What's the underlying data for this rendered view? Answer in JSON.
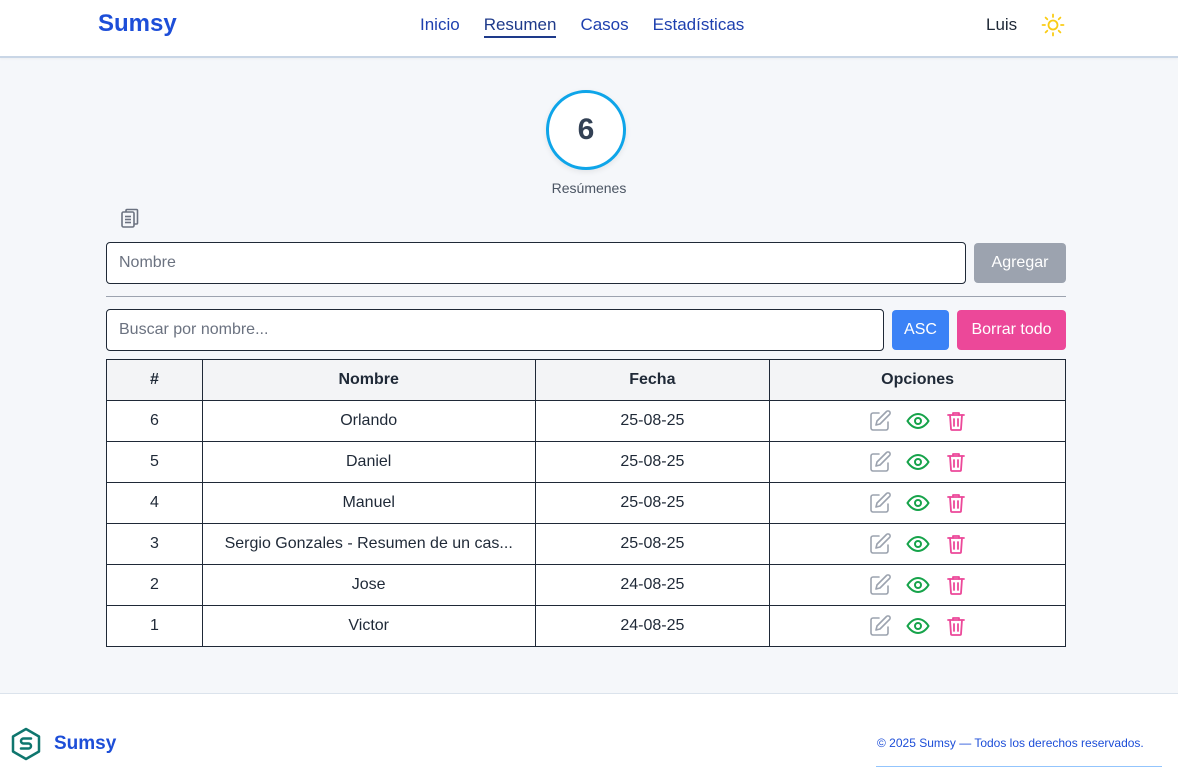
{
  "header": {
    "brand": "Sumsy",
    "nav": [
      {
        "label": "Inicio",
        "active": false
      },
      {
        "label": "Resumen",
        "active": true
      },
      {
        "label": "Casos",
        "active": false
      },
      {
        "label": "Estadísticas",
        "active": false
      }
    ],
    "user": "Luis",
    "theme_icon": "sun-icon"
  },
  "summary": {
    "count": "6",
    "label": "Resúmenes",
    "copy_icon": "clipboard-icon"
  },
  "add_form": {
    "name_placeholder": "Nombre",
    "add_label": "Agregar"
  },
  "search": {
    "placeholder": "Buscar por nombre...",
    "sort_label": "ASC",
    "clear_label": "Borrar todo"
  },
  "table": {
    "headers": [
      "#",
      "Nombre",
      "Fecha",
      "Opciones"
    ],
    "rows": [
      {
        "num": "6",
        "name": "Orlando",
        "date": "25-08-25"
      },
      {
        "num": "5",
        "name": "Daniel",
        "date": "25-08-25"
      },
      {
        "num": "4",
        "name": "Manuel",
        "date": "25-08-25"
      },
      {
        "num": "3",
        "name": "Sergio Gonzales - Resumen de un cas...",
        "date": "25-08-25"
      },
      {
        "num": "2",
        "name": "Jose",
        "date": "24-08-25"
      },
      {
        "num": "1",
        "name": "Victor",
        "date": "24-08-25"
      }
    ],
    "option_icons": [
      "edit-icon",
      "view-icon",
      "delete-icon"
    ]
  },
  "colors": {
    "brand": "#1d4ed8",
    "counter_ring": "#0ea5e9",
    "sort_button": "#3b82f6",
    "clear_button": "#ec4899",
    "add_button": "#9ca3af",
    "view_icon": "#16a34a",
    "delete_icon": "#ec4899",
    "edit_icon": "#9ca3af"
  },
  "footer": {
    "brand": "Sumsy",
    "copyright": "© 2025 Sumsy — Todos los derechos reservados."
  }
}
